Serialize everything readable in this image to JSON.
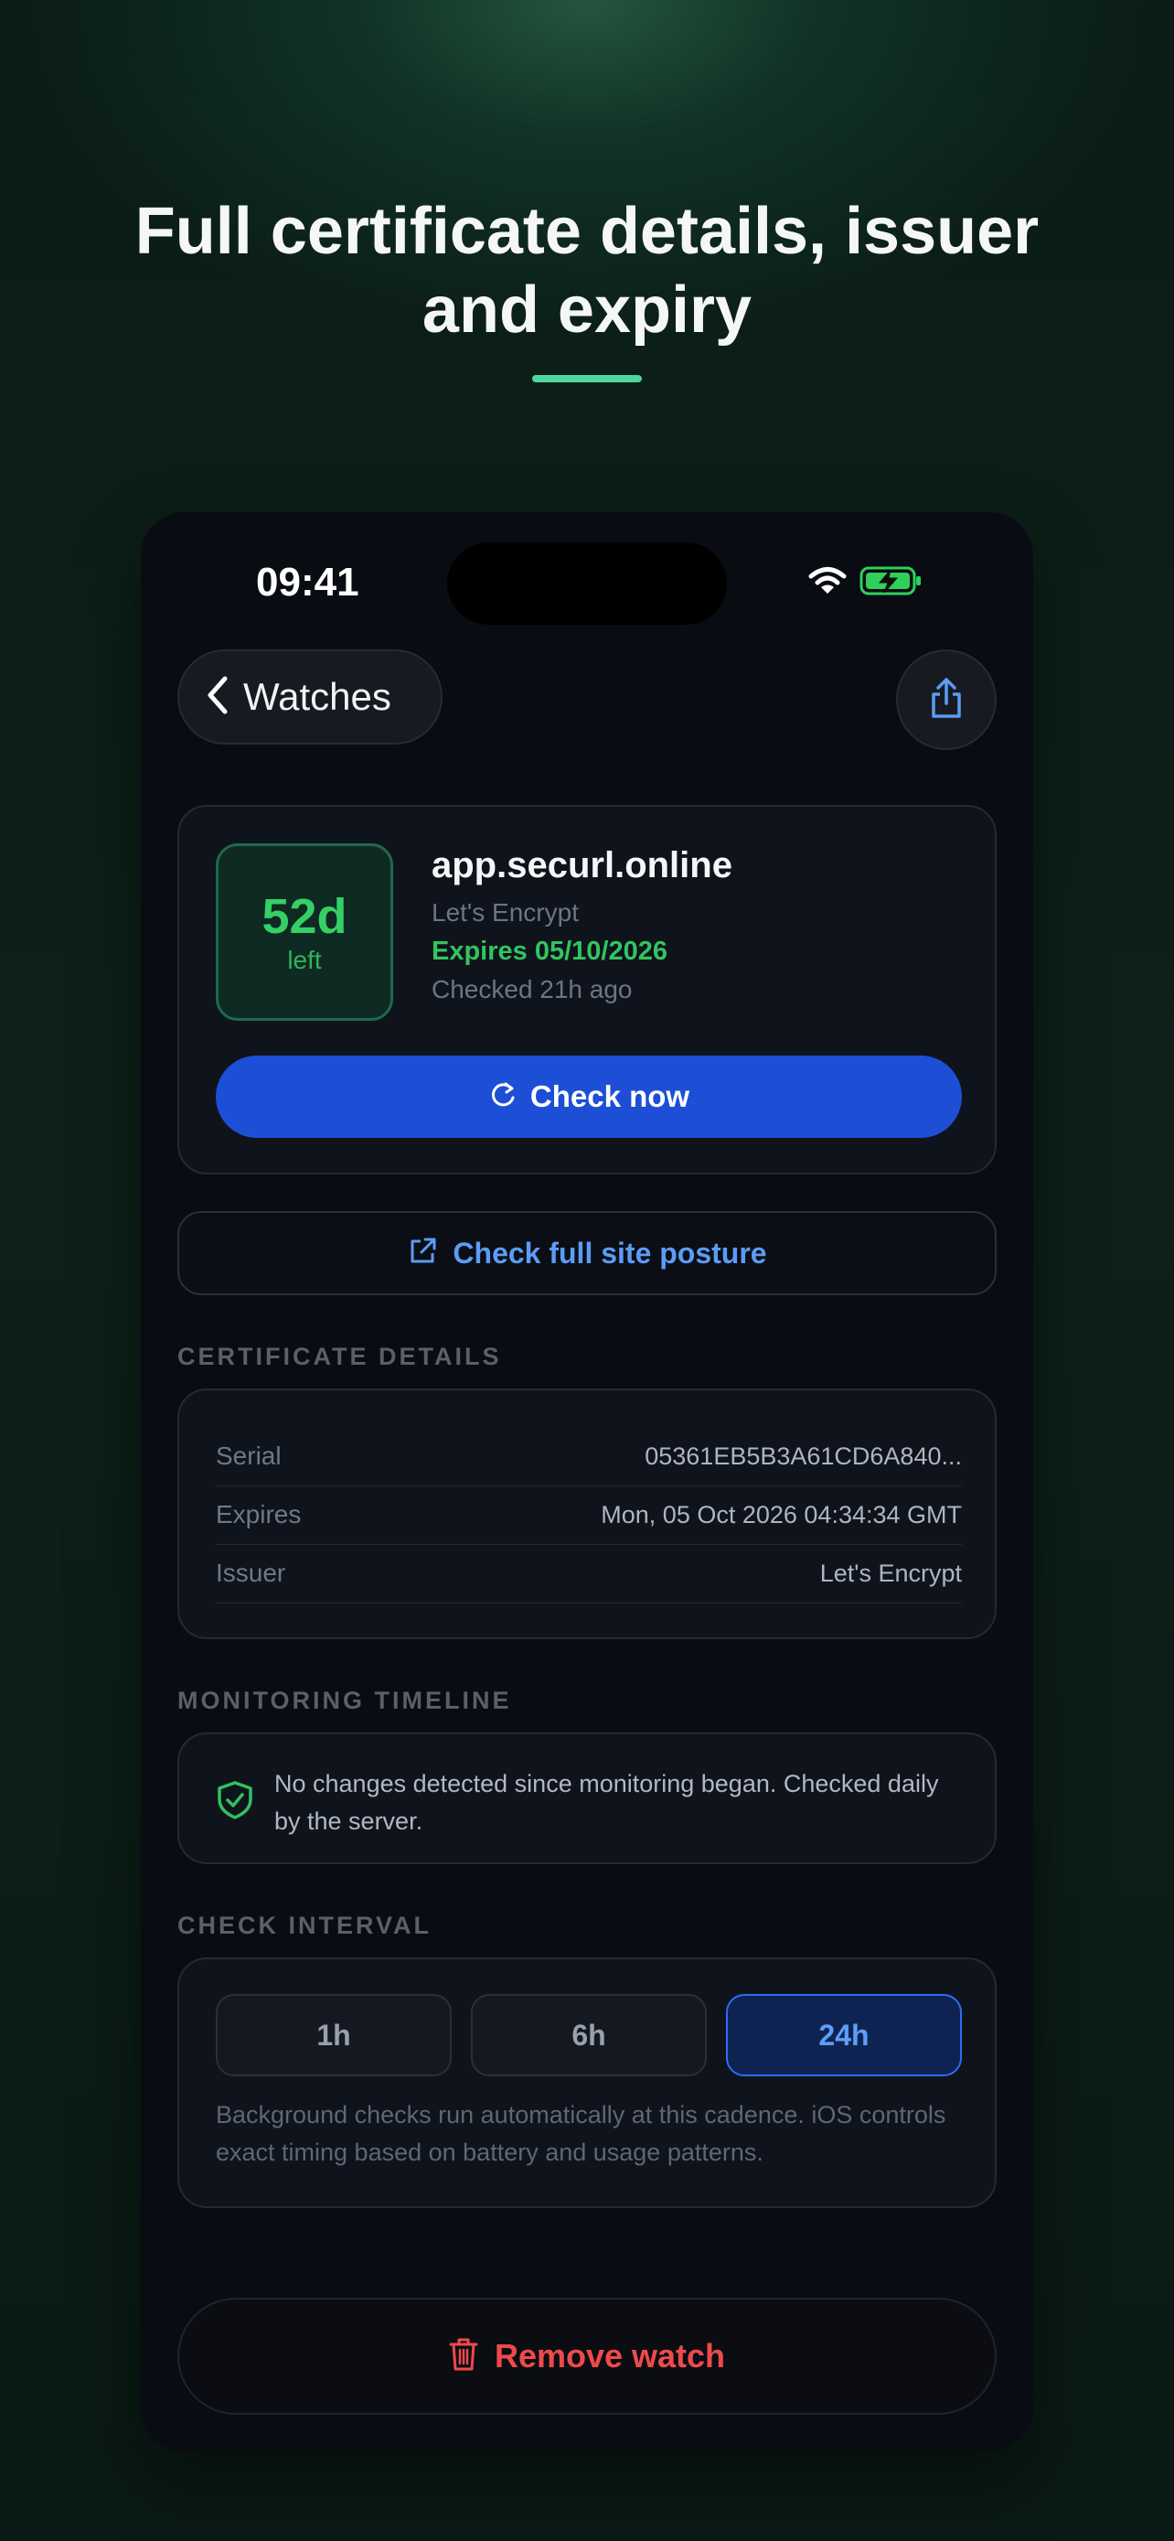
{
  "headline": {
    "line1": "Full certificate details, issuer",
    "line2": "and expiry"
  },
  "status_bar": {
    "time": "09:41",
    "icons": [
      "wifi-icon",
      "battery-charging-icon"
    ]
  },
  "nav": {
    "back_label": "Watches",
    "share_icon": "share-icon"
  },
  "watch": {
    "days_left": "52d",
    "days_left_suffix": "left",
    "domain": "app.securl.online",
    "issuer": "Let's Encrypt",
    "expires": "Expires 05/10/2026",
    "checked": "Checked 21h ago",
    "check_now_label": "Check now"
  },
  "posture_link": "Check full site posture",
  "certificate_details": {
    "section_label": "CERTIFICATE DETAILS",
    "rows": [
      {
        "key": "Serial",
        "value": "05361EB5B3A61CD6A840..."
      },
      {
        "key": "Expires",
        "value": "Mon, 05 Oct 2026 04:34:34 GMT"
      },
      {
        "key": "Issuer",
        "value": "Let's Encrypt"
      }
    ]
  },
  "monitoring_timeline": {
    "section_label": "MONITORING TIMELINE",
    "text": "No changes detected since monitoring began. Checked daily by the server."
  },
  "check_interval": {
    "section_label": "CHECK INTERVAL",
    "options": [
      "1h",
      "6h",
      "24h"
    ],
    "selected": "24h",
    "note": "Background checks run automatically at this cadence. iOS controls exact timing based on battery and usage patterns."
  },
  "remove_label": "Remove watch",
  "colors": {
    "accent_green": "#34d065",
    "accent_blue": "#1d4fd6",
    "link_blue": "#5b9cf5",
    "danger_red": "#ef4a4a",
    "underline_mint": "#4ed6a0"
  }
}
